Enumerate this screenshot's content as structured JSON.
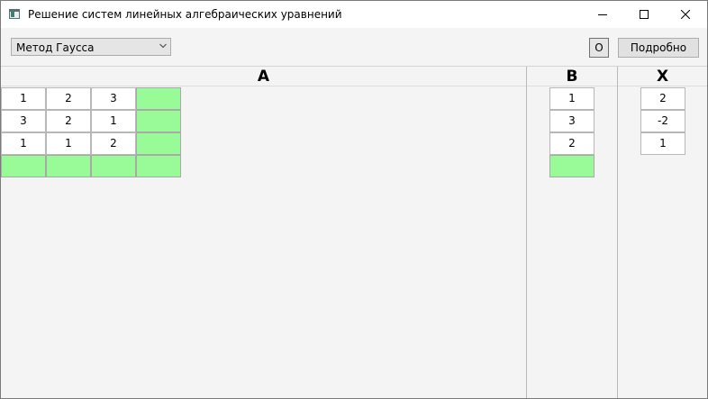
{
  "window": {
    "title": "Решение систем линейных алгебраических уравнений",
    "icon": "app-window-icon"
  },
  "toolbar": {
    "method_selected": "Метод Гаусса",
    "o_label": "O",
    "detail_label": "Подробно"
  },
  "panels": {
    "a_header": "A",
    "b_header": "B",
    "x_header": "X"
  },
  "matrix_a": [
    [
      "1",
      "2",
      "3",
      ""
    ],
    [
      "3",
      "2",
      "1",
      ""
    ],
    [
      "1",
      "1",
      "2",
      ""
    ],
    [
      "",
      "",
      "",
      ""
    ]
  ],
  "vector_b": [
    "1",
    "3",
    "2",
    ""
  ],
  "vector_x": [
    "2",
    "-2",
    "1"
  ],
  "colors": {
    "highlight": "#98fb98",
    "cell_border": "#b7b7b7",
    "background": "#f4f4f4"
  }
}
